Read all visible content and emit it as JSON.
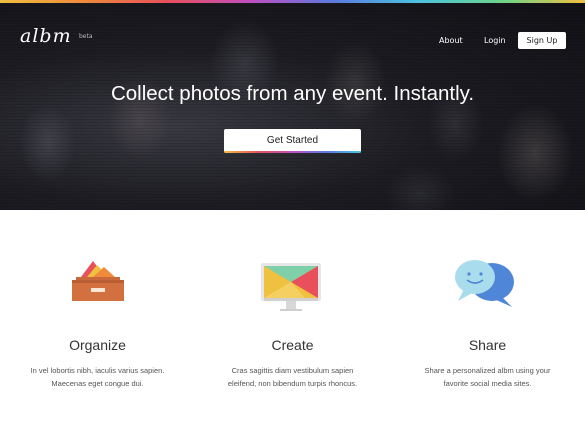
{
  "header": {
    "logo_text": "albm",
    "logo_badge": "beta",
    "nav": {
      "about": "About",
      "login": "Login",
      "signup": "Sign Up"
    }
  },
  "hero": {
    "headline": "Collect photos from any event. Instantly.",
    "cta_label": "Get Started"
  },
  "features": [
    {
      "icon": "drawer-icon",
      "title": "Organize",
      "description_line1": "In vel lobortis nibh, iaculis varius sapien.",
      "description_line2": "Maecenas eget congue dui."
    },
    {
      "icon": "monitor-icon",
      "title": "Create",
      "description_line1": "Cras sagittis diam vestibulum sapien",
      "description_line2": "eleifend, non bibendum turpis rhoncus."
    },
    {
      "icon": "chat-bubbles-icon",
      "title": "Share",
      "description_line1": "Share a personalized albm using your",
      "description_line2": "favorite social media sites."
    }
  ],
  "colors": {
    "accent_yellow": "#f0c040",
    "accent_orange": "#f08a3c",
    "accent_red": "#e8505b",
    "accent_teal": "#4cc3e0",
    "hero_bg": "#1c1c22"
  }
}
